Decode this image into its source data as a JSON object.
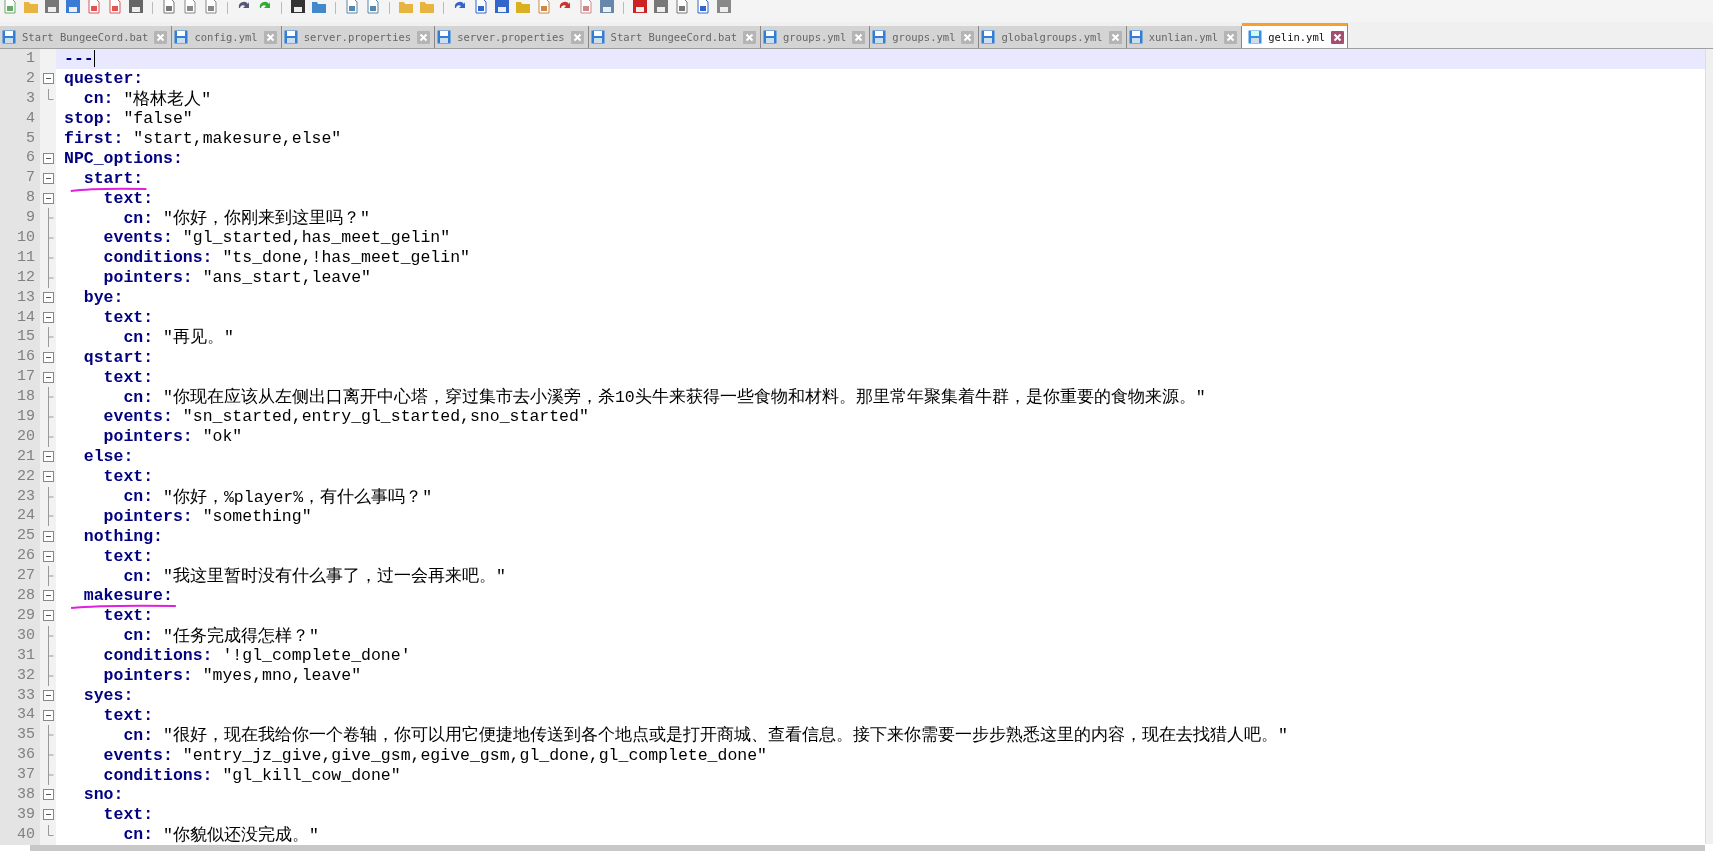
{
  "tabs": [
    {
      "label": "Start BungeeCord.bat",
      "selected": false
    },
    {
      "label": "config.yml",
      "selected": false
    },
    {
      "label": "server.properties",
      "selected": false
    },
    {
      "label": "server.properties",
      "selected": false
    },
    {
      "label": "Start BungeeCord.bat",
      "selected": false
    },
    {
      "label": "groups.yml",
      "selected": false
    },
    {
      "label": "groups.yml",
      "selected": false
    },
    {
      "label": "globalgroups.yml",
      "selected": false
    },
    {
      "label": "xunlian.yml",
      "selected": false
    },
    {
      "label": "gelin.yml",
      "selected": true
    }
  ],
  "editor": {
    "lines": [
      {
        "n": "1",
        "kind": "plain",
        "key": "---",
        "current": true,
        "underlined": false
      },
      {
        "n": "2",
        "kind": "fold",
        "key": "quester:",
        "current": false,
        "underlined": false
      },
      {
        "n": "3",
        "kind": "last",
        "key": "  cn:",
        "value": "\"格林老人\"",
        "current": false,
        "underlined": false
      },
      {
        "n": "4",
        "kind": "plain",
        "key": "stop:",
        "value": "\"false\"",
        "current": false,
        "underlined": false
      },
      {
        "n": "5",
        "kind": "plain",
        "key": "first:",
        "value": "\"start,makesure,else\"",
        "current": false,
        "underlined": false
      },
      {
        "n": "6",
        "kind": "fold",
        "key": "NPC_options:",
        "current": false,
        "underlined": false
      },
      {
        "n": "7",
        "kind": "fold",
        "key": "  start:",
        "current": false,
        "underlined": true
      },
      {
        "n": "8",
        "kind": "fold",
        "key": "    text:",
        "current": false,
        "underlined": false
      },
      {
        "n": "9",
        "kind": "inner",
        "key": "      cn:",
        "value": "\"你好，你刚来到这里吗？\"",
        "current": false,
        "underlined": false
      },
      {
        "n": "10",
        "kind": "inner",
        "key": "    events:",
        "value": "\"gl_started,has_meet_gelin\"",
        "current": false,
        "underlined": false
      },
      {
        "n": "11",
        "kind": "inner",
        "key": "    conditions:",
        "value": "\"ts_done,!has_meet_gelin\"",
        "current": false,
        "underlined": false
      },
      {
        "n": "12",
        "kind": "inner",
        "key": "    pointers:",
        "value": "\"ans_start,leave\"",
        "current": false,
        "underlined": false
      },
      {
        "n": "13",
        "kind": "fold",
        "key": "  bye:",
        "current": false,
        "underlined": false
      },
      {
        "n": "14",
        "kind": "fold",
        "key": "    text:",
        "current": false,
        "underlined": false
      },
      {
        "n": "15",
        "kind": "inner",
        "key": "      cn:",
        "value": "\"再见。\"",
        "current": false,
        "underlined": false
      },
      {
        "n": "16",
        "kind": "fold",
        "key": "  qstart:",
        "current": false,
        "underlined": false
      },
      {
        "n": "17",
        "kind": "fold",
        "key": "    text:",
        "current": false,
        "underlined": false
      },
      {
        "n": "18",
        "kind": "inner",
        "key": "      cn:",
        "value": "\"你现在应该从左侧出口离开中心塔，穿过集市去小溪旁，杀10头牛来获得一些食物和材料。那里常年聚集着牛群，是你重要的食物来源。\"",
        "current": false,
        "underlined": false
      },
      {
        "n": "19",
        "kind": "inner",
        "key": "    events:",
        "value": "\"sn_started,entry_gl_started,sno_started\"",
        "current": false,
        "underlined": false
      },
      {
        "n": "20",
        "kind": "inner",
        "key": "    pointers:",
        "value": "\"ok\"",
        "current": false,
        "underlined": false
      },
      {
        "n": "21",
        "kind": "fold",
        "key": "  else:",
        "current": false,
        "underlined": false
      },
      {
        "n": "22",
        "kind": "fold",
        "key": "    text:",
        "current": false,
        "underlined": false
      },
      {
        "n": "23",
        "kind": "inner",
        "key": "      cn:",
        "value": "\"你好，%player%，有什么事吗？\"",
        "current": false,
        "underlined": false
      },
      {
        "n": "24",
        "kind": "inner",
        "key": "    pointers:",
        "value": "\"something\"",
        "current": false,
        "underlined": false
      },
      {
        "n": "25",
        "kind": "fold",
        "key": "  nothing:",
        "current": false,
        "underlined": false
      },
      {
        "n": "26",
        "kind": "fold",
        "key": "    text:",
        "current": false,
        "underlined": false
      },
      {
        "n": "27",
        "kind": "inner",
        "key": "      cn:",
        "value": "\"我这里暂时没有什么事了，过一会再来吧。\"",
        "current": false,
        "underlined": false
      },
      {
        "n": "28",
        "kind": "fold",
        "key": "  makesure:",
        "current": false,
        "underlined": true
      },
      {
        "n": "29",
        "kind": "fold",
        "key": "    text:",
        "current": false,
        "underlined": false
      },
      {
        "n": "30",
        "kind": "inner",
        "key": "      cn:",
        "value": "\"任务完成得怎样？\"",
        "current": false,
        "underlined": false
      },
      {
        "n": "31",
        "kind": "inner",
        "key": "    conditions:",
        "value": "'!gl_complete_done'",
        "current": false,
        "underlined": false
      },
      {
        "n": "32",
        "kind": "inner",
        "key": "    pointers:",
        "value": "\"myes,mno,leave\"",
        "current": false,
        "underlined": false
      },
      {
        "n": "33",
        "kind": "fold",
        "key": "  syes:",
        "current": false,
        "underlined": false
      },
      {
        "n": "34",
        "kind": "fold",
        "key": "    text:",
        "current": false,
        "underlined": false
      },
      {
        "n": "35",
        "kind": "inner",
        "key": "      cn:",
        "value": "\"很好，现在我给你一个卷轴，你可以用它便捷地传送到各个地点或是打开商城、查看信息。接下来你需要一步步熟悉这里的内容，现在去找猎人吧。\"",
        "current": false,
        "underlined": false
      },
      {
        "n": "36",
        "kind": "inner",
        "key": "    events:",
        "value": "\"entry_jz_give,give_gsm,egive_gsm,gl_done,gl_complete_done\"",
        "current": false,
        "underlined": false
      },
      {
        "n": "37",
        "kind": "inner",
        "key": "    conditions:",
        "value": "\"gl_kill_cow_done\"",
        "current": false,
        "underlined": false
      },
      {
        "n": "38",
        "kind": "fold",
        "key": "  sno:",
        "current": false,
        "underlined": false
      },
      {
        "n": "39",
        "kind": "fold",
        "key": "    text:",
        "current": false,
        "underlined": false
      },
      {
        "n": "40",
        "kind": "last",
        "key": "      cn:",
        "value": "\"你貌似还没完成。\"",
        "current": false,
        "underlined": false
      }
    ]
  }
}
